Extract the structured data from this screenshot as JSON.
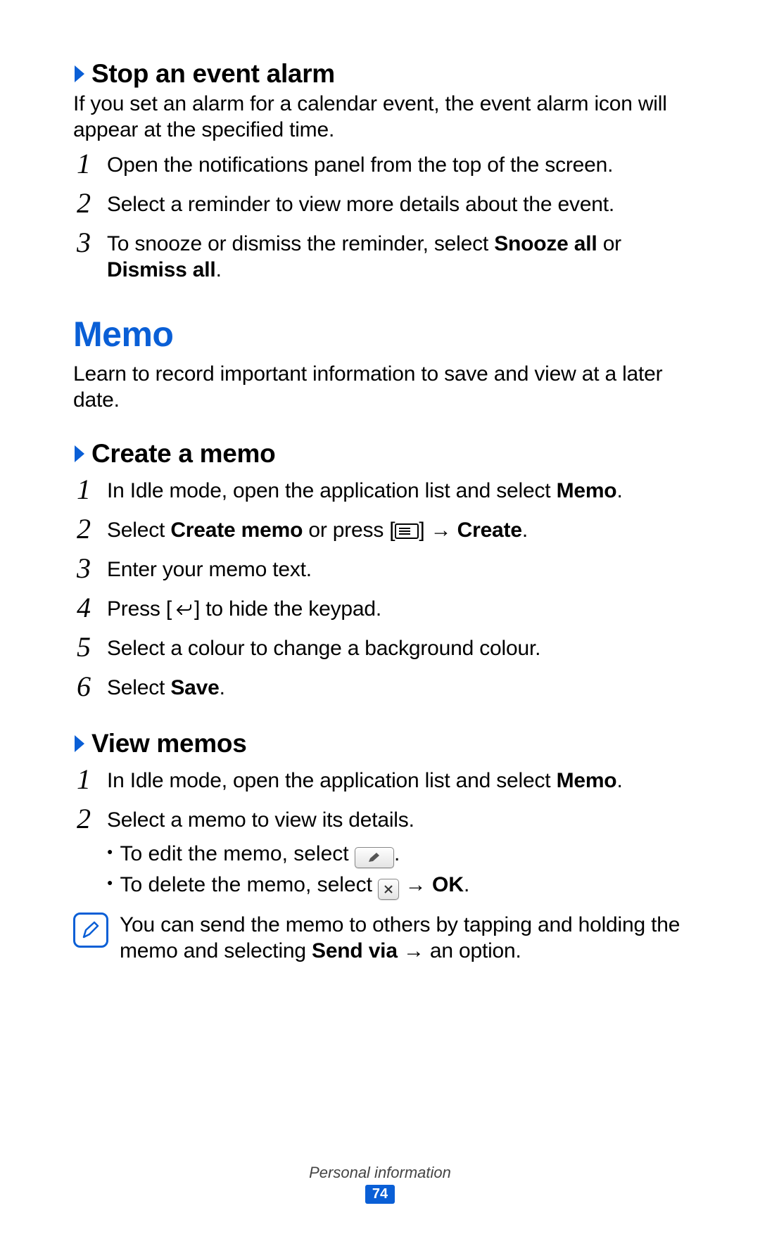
{
  "colors": {
    "accent": "#0a5fd6"
  },
  "section1": {
    "title": "Stop an event alarm",
    "intro": "If you set an alarm for a calendar event, the event alarm icon will appear at the specified time.",
    "steps": {
      "s1": "Open the notifications panel from the top of the screen.",
      "s2": "Select a reminder to view more details about the event.",
      "s3_pre": "To snooze or dismiss the reminder, select ",
      "s3_b1": "Snooze all",
      "s3_mid": " or ",
      "s3_b2": "Dismiss all",
      "s3_end": "."
    }
  },
  "memo": {
    "title": "Memo",
    "intro": "Learn to record important information to save and view at a later date."
  },
  "create": {
    "title": "Create a memo",
    "s1_pre": "In Idle mode, open the application list and select ",
    "s1_b": "Memo",
    "s1_end": ".",
    "s2_pre": "Select ",
    "s2_b1": "Create memo",
    "s2_mid": " or press [",
    "s2_post_icon": "] → ",
    "s2_b2": "Create",
    "s2_end": ".",
    "s3": "Enter your memo text.",
    "s4_pre": "Press [",
    "s4_post": "] to hide the keypad.",
    "s5": "Select a colour to change a background colour.",
    "s6_pre": "Select ",
    "s6_b": "Save",
    "s6_end": "."
  },
  "view": {
    "title": "View memos",
    "s1_pre": "In Idle mode, open the application list and select ",
    "s1_b": "Memo",
    "s1_end": ".",
    "s2": "Select a memo to view its details.",
    "b1_pre": "To edit the memo, select ",
    "b1_end": ".",
    "b2_pre": "To delete the memo, select ",
    "b2_mid": " → ",
    "b2_b": "OK",
    "b2_end": ".",
    "note_pre": "You can send the memo to others by tapping and holding the memo and selecting ",
    "note_b": "Send via",
    "note_end": " → an option."
  },
  "nums": {
    "n1": "1",
    "n2": "2",
    "n3": "3",
    "n4": "4",
    "n5": "5",
    "n6": "6"
  },
  "bullet": "●",
  "footer": {
    "category": "Personal information",
    "page": "74"
  }
}
